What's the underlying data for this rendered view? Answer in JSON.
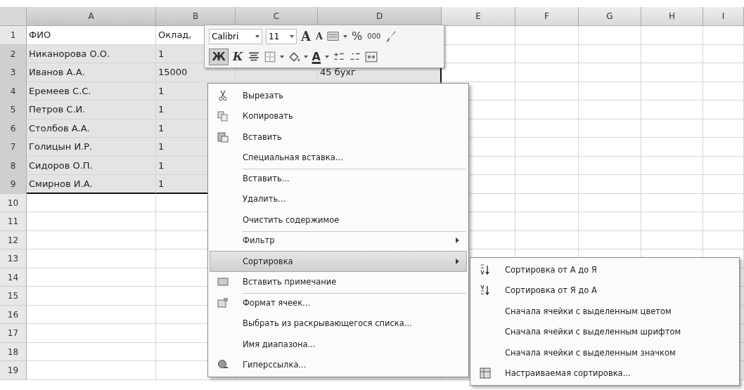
{
  "sheet": {
    "columns": [
      {
        "label": "A",
        "selected": true
      },
      {
        "label": "B",
        "selected": true
      },
      {
        "label": "C",
        "selected": true
      },
      {
        "label": "D",
        "selected": true
      },
      {
        "label": "E",
        "selected": false
      },
      {
        "label": "F",
        "selected": false
      },
      {
        "label": "G",
        "selected": false
      },
      {
        "label": "H",
        "selected": false
      },
      {
        "label": "I",
        "selected": false
      }
    ],
    "rows": [
      {
        "number": "1",
        "selected": false,
        "cells": [
          "ФИО",
          "Оклад,"
        ]
      },
      {
        "number": "2",
        "selected": true,
        "cells": [
          "Никанорова О.О.",
          "1"
        ]
      },
      {
        "number": "3",
        "selected": true,
        "cells": [
          "Иванов А.А.",
          "15000",
          "",
          "45 бухг"
        ]
      },
      {
        "number": "4",
        "selected": true,
        "cells": [
          "Еремеев С.С.",
          "1"
        ]
      },
      {
        "number": "5",
        "selected": true,
        "cells": [
          "Петров С.И.",
          "1"
        ]
      },
      {
        "number": "6",
        "selected": true,
        "cells": [
          "Столбов А.А.",
          "1"
        ]
      },
      {
        "number": "7",
        "selected": true,
        "cells": [
          "Голицын И.Р.",
          "1"
        ]
      },
      {
        "number": "8",
        "selected": true,
        "cells": [
          "Сидоров О.П.",
          "1"
        ]
      },
      {
        "number": "9",
        "selected": true,
        "cells": [
          "Смирнов И.А.",
          "1"
        ]
      },
      {
        "number": "10",
        "selected": false,
        "cells": []
      },
      {
        "number": "11",
        "selected": false,
        "cells": []
      },
      {
        "number": "12",
        "selected": false,
        "cells": []
      },
      {
        "number": "13",
        "selected": false,
        "cells": []
      },
      {
        "number": "14",
        "selected": false,
        "cells": []
      },
      {
        "number": "15",
        "selected": false,
        "cells": []
      },
      {
        "number": "16",
        "selected": false,
        "cells": []
      },
      {
        "number": "17",
        "selected": false,
        "cells": []
      },
      {
        "number": "18",
        "selected": false,
        "cells": []
      },
      {
        "number": "19",
        "selected": false,
        "cells": []
      }
    ]
  },
  "mini_toolbar": {
    "font": "Calibri",
    "size": "11",
    "grow": "A",
    "shrink": "A",
    "percent": "%",
    "thousands": "000",
    "bold": {
      "label": "Ж",
      "selected": true
    },
    "italic": "К",
    "font_color": "A"
  },
  "context_menu": [
    {
      "label": "Вырезать",
      "kind": "cut",
      "separator_before": false,
      "submenu": false,
      "selected": false
    },
    {
      "label": "Копировать",
      "kind": "copy",
      "separator_before": false,
      "submenu": false,
      "selected": false
    },
    {
      "label": "Вставить",
      "kind": "paste",
      "separator_before": false,
      "submenu": false,
      "selected": false
    },
    {
      "label": "Специальная вставка...",
      "kind": "plain",
      "separator_before": false,
      "submenu": false,
      "selected": false
    },
    {
      "label": "Вставить...",
      "kind": "plain",
      "separator_before": true,
      "submenu": false,
      "selected": false
    },
    {
      "label": "Удалить...",
      "kind": "plain",
      "separator_before": false,
      "submenu": false,
      "selected": false
    },
    {
      "label": "Очистить содержимое",
      "kind": "plain",
      "separator_before": false,
      "submenu": false,
      "selected": false
    },
    {
      "label": "Фильтр",
      "kind": "plain",
      "separator_before": true,
      "submenu": true,
      "selected": false
    },
    {
      "label": "Сортировка",
      "kind": "plain",
      "separator_before": false,
      "submenu": true,
      "selected": true
    },
    {
      "label": "Вставить примечание",
      "kind": "comment",
      "separator_before": false,
      "submenu": false,
      "selected": false
    },
    {
      "label": "Формат ячеек...",
      "kind": "format",
      "separator_before": true,
      "submenu": false,
      "selected": false
    },
    {
      "label": "Выбрать из раскрывающегося списка...",
      "kind": "plain",
      "separator_before": false,
      "submenu": false,
      "selected": false
    },
    {
      "label": "Имя диапазона...",
      "kind": "plain",
      "separator_before": false,
      "submenu": false,
      "selected": false
    },
    {
      "label": "Гиперссылка...",
      "kind": "link",
      "separator_before": false,
      "submenu": false,
      "selected": false
    }
  ],
  "sort_submenu": [
    {
      "label": "Сортировка от А до Я",
      "kind": "az"
    },
    {
      "label": "Сортировка от Я до А",
      "kind": "za"
    },
    {
      "label": "Сначала ячейки с выделенным цветом",
      "kind": "plain"
    },
    {
      "label": "Сначала ячейки с выделенным шрифтом",
      "kind": "plain"
    },
    {
      "label": "Сначала ячейки с выделенным значком",
      "kind": "plain"
    },
    {
      "label": "Настраиваемая сортировка...",
      "kind": "custom"
    }
  ]
}
